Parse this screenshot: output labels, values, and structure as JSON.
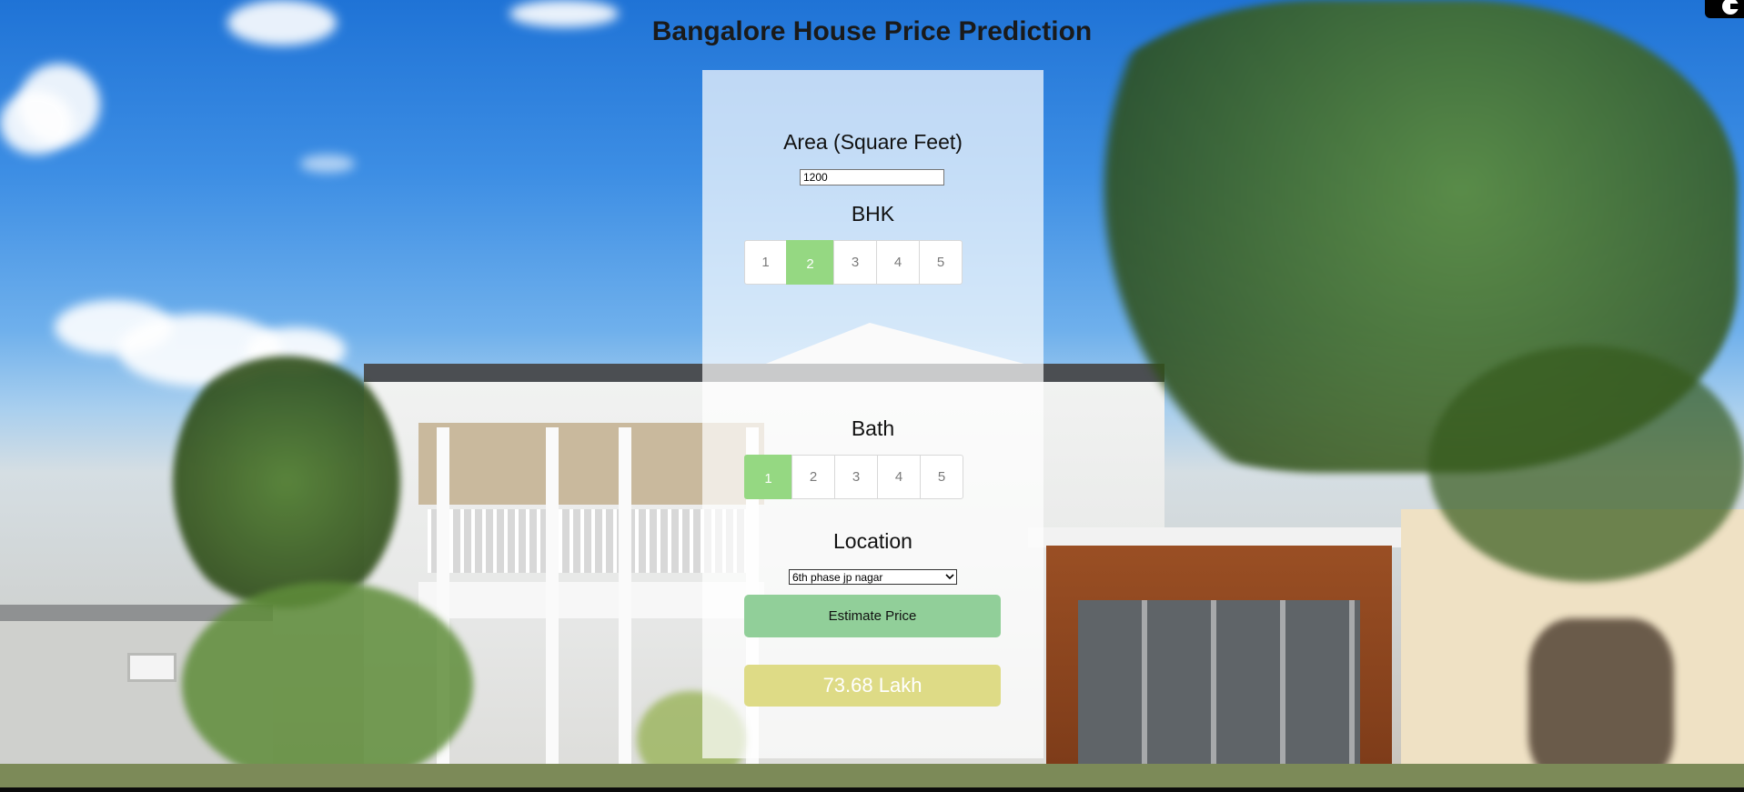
{
  "page": {
    "title": "Bangalore House Price Prediction"
  },
  "form": {
    "area_label": "Area (Square Feet)",
    "area_value": "1200",
    "bhk_label": "BHK",
    "bhk_options": [
      "1",
      "2",
      "3",
      "4",
      "5"
    ],
    "bhk_selected": "2",
    "bath_label": "Bath",
    "bath_options": [
      "1",
      "2",
      "3",
      "4",
      "5"
    ],
    "bath_selected": "1",
    "location_label": "Location",
    "location_selected": "6th phase jp nagar",
    "estimate_button": "Estimate Price",
    "result": "73.68 Lakh"
  },
  "colors": {
    "selected_option": "#95d882",
    "estimate_button": "#91cf99",
    "result_box": "#dedb86",
    "panel": "rgba(255,255,255,0.70)"
  },
  "icons": {
    "corner_badge": "extension-icon",
    "select_arrow": "chevron-down-icon"
  }
}
